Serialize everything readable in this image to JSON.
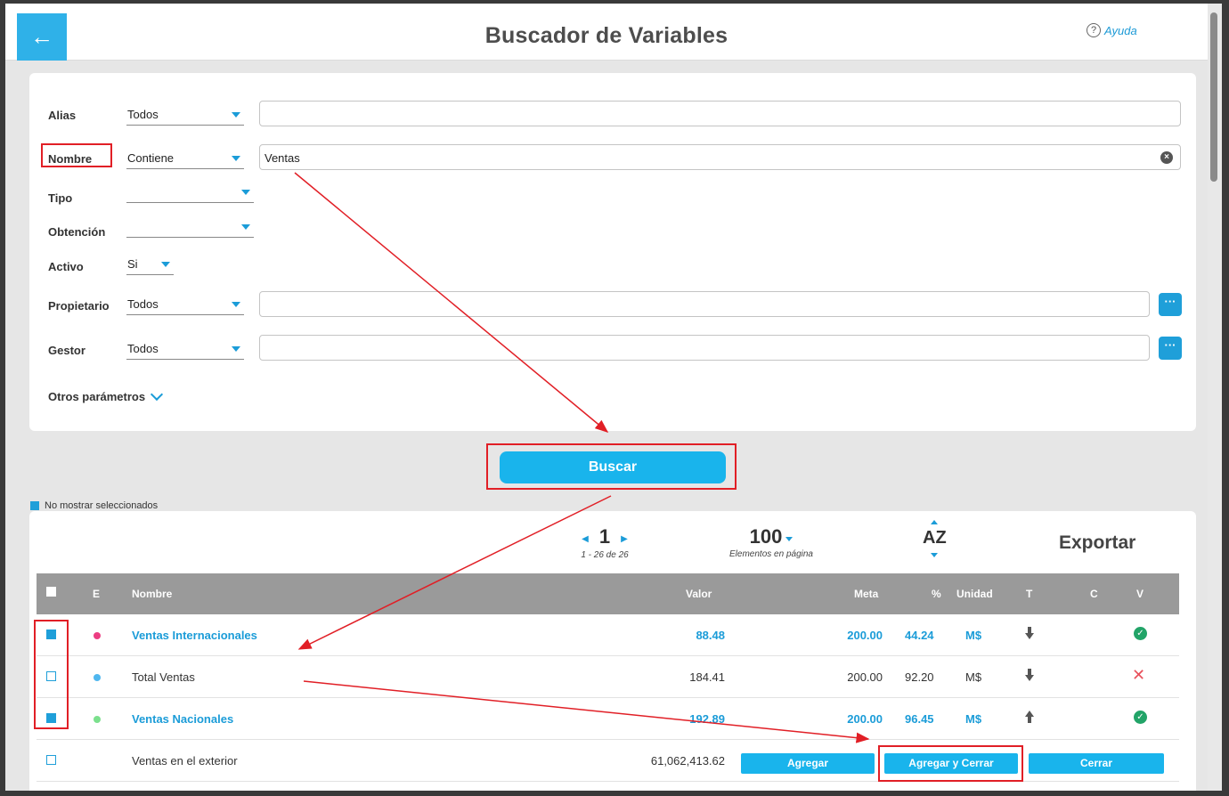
{
  "header": {
    "title": "Buscador de Variables",
    "back_icon": "arrow-left-icon",
    "help_label": "Ayuda",
    "help_icon": "?"
  },
  "filters": {
    "alias": {
      "label": "Alias",
      "operator": "Todos",
      "value": ""
    },
    "nombre": {
      "label": "Nombre",
      "operator": "Contiene",
      "value": "Ventas"
    },
    "tipo": {
      "label": "Tipo",
      "value": ""
    },
    "obtencion": {
      "label": "Obtención",
      "value": ""
    },
    "activo": {
      "label": "Activo",
      "value": "Si"
    },
    "propietario": {
      "label": "Propietario",
      "operator": "Todos",
      "value": ""
    },
    "gestor": {
      "label": "Gestor",
      "operator": "Todos",
      "value": ""
    },
    "more_label": "Otros parámetros",
    "dots_label": "···"
  },
  "search_button": "Buscar",
  "hide_selected_label": "No mostrar seleccionados",
  "pagination": {
    "page": "1",
    "range": "1 - 26 de 26",
    "per_page": "100",
    "per_page_label": "Elementos en página",
    "sort_label": "AZ",
    "export_label": "Exportar"
  },
  "table": {
    "headers": {
      "e": "E",
      "nombre": "Nombre",
      "valor": "Valor",
      "meta": "Meta",
      "pct": "%",
      "unidad": "Unidad",
      "t": "T",
      "c": "C",
      "v": "V"
    },
    "rows": [
      {
        "nombre": "Ventas Internacionales",
        "valor": "88.48",
        "meta": "200.00",
        "pct": "44.24",
        "unidad": "M$",
        "checked": true,
        "status_color": "#ec3d82",
        "trend": "down",
        "v": "ok"
      },
      {
        "nombre": "Total Ventas",
        "valor": "184.41",
        "meta": "200.00",
        "pct": "92.20",
        "unidad": "M$",
        "checked": false,
        "status_color": "#4fb7ef",
        "trend": "down",
        "v": "x"
      },
      {
        "nombre": "Ventas Nacionales",
        "valor": "192.89",
        "meta": "200.00",
        "pct": "96.45",
        "unidad": "M$",
        "checked": true,
        "status_color": "#7be08d",
        "trend": "up",
        "v": "ok"
      },
      {
        "nombre": "Ventas en el exterior",
        "valor": "61,062,413.62",
        "checked": false
      }
    ]
  },
  "actions": {
    "add": "Agregar",
    "add_close": "Agregar y Cerrar",
    "close": "Cerrar"
  },
  "colors": {
    "accent": "#19b4ec",
    "highlight": "#e11f26",
    "header_gray": "#9a9a9a"
  }
}
